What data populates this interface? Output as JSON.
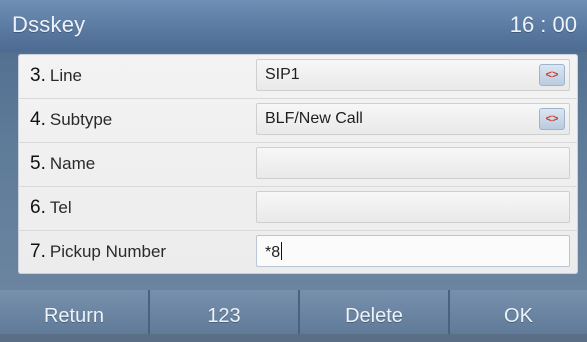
{
  "titlebar": {
    "title": "Dsskey",
    "time": "16 : 00"
  },
  "rows": [
    {
      "num": "3.",
      "label": "Line",
      "value": "SIP1",
      "has_switch": true
    },
    {
      "num": "4.",
      "label": "Subtype",
      "value": "BLF/New Call",
      "has_switch": true
    },
    {
      "num": "5.",
      "label": "Name",
      "value": "",
      "has_switch": false
    },
    {
      "num": "6.",
      "label": "Tel",
      "value": "",
      "has_switch": false
    },
    {
      "num": "7.",
      "label": "Pickup Number",
      "value": "*8",
      "has_switch": false,
      "active": true
    }
  ],
  "switch_glyph": "<>",
  "softkeys": [
    "Return",
    "123",
    "Delete",
    "OK"
  ],
  "colors": {
    "accent": "#5878a0",
    "switch_arrow": "#d23a2c"
  },
  "icons": {
    "switch": "left-right-switch-icon"
  }
}
